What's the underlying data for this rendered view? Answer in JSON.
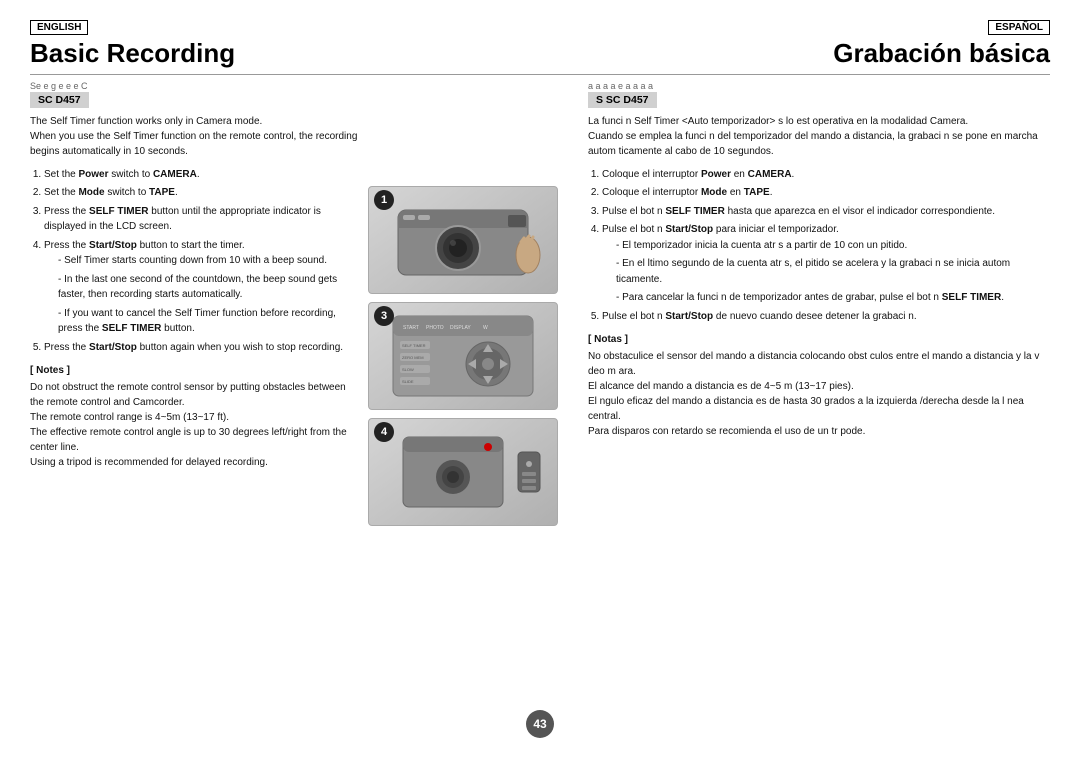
{
  "page": {
    "background": "#ffffff",
    "page_number": "43"
  },
  "left": {
    "lang_badge": "ENGLISH",
    "title": "Basic Recording",
    "model_label_text": "Se  e    g  e  e  e C",
    "model_code": "SC  D457",
    "description": [
      "The Self Timer function works only in Camera mode.",
      "When you use the Self Timer function on the remote control, the recording begins automatically in 10 seconds."
    ],
    "steps": [
      {
        "num": 1,
        "text": "Set the ",
        "bold_word": "Power",
        "text2": " switch to ",
        "bold_word2": "CAMERA",
        "text3": "."
      },
      {
        "num": 2,
        "text": "Set the ",
        "bold_word": "Mode",
        "text2": " switch to ",
        "bold_word2": "TAPE",
        "text3": "."
      },
      {
        "num": 3,
        "text": "Press the ",
        "bold_word": "SELF TIMER",
        "text2": " button until the appropriate indicator is displayed in the LCD screen."
      },
      {
        "num": 4,
        "text": "Press the ",
        "bold_word": "Start/Stop",
        "text2": " button to start the timer.",
        "bullets": [
          "Self Timer starts counting down from 10 with a beep sound.",
          "In the last one second of the countdown, the beep sound gets faster, then recording starts automatically.",
          "If you want to cancel the Self Timer function before recording, press the SELF TIMER button."
        ]
      },
      {
        "num": 5,
        "text": "Press the ",
        "bold_word": "Start/Stop",
        "text2": " button again when you wish to stop recording."
      }
    ],
    "notes_title": "[ Notes ]",
    "notes": [
      "Do not obstruct the remote control sensor by putting obstacles between the remote control and Camcorder.",
      "The remote control range is 4~5m (13~17 ft).",
      "The effective remote control angle is up to 30 degrees left/right from the center line.",
      "Using a tripod is recommended for delayed recording."
    ]
  },
  "right": {
    "lang_badge": "ESPAÑOL",
    "title": "Grabación básica",
    "model_label_text": "a  a      a      a   e  a     a   a     a",
    "model_code": "S   SC  D457",
    "description": [
      "La funci n Self Timer <Auto temporizador> s lo est  operativa en la modalidad Camera.",
      "Cuando se emplea la funci n del temporizador del mando a distancia, la grabaci n se pone en marcha autom ticamente al cabo de 10 segundos."
    ],
    "steps": [
      {
        "num": 1,
        "text": "Coloque el interruptor ",
        "bold_word": "Power",
        "text2": " en ",
        "bold_word2": "CAMERA",
        "text3": "."
      },
      {
        "num": 2,
        "text": "Coloque el interruptor ",
        "bold_word": "Mode",
        "text2": " en ",
        "bold_word2": "TAPE",
        "text3": "."
      },
      {
        "num": 3,
        "text": "Pulse el bot n ",
        "bold_word": "SELF TIMER",
        "text2": " hasta que aparezca en el visor el indicador correspondiente."
      },
      {
        "num": 4,
        "text": "Pulse el bot n ",
        "bold_word": "Start/Stop",
        "text2": " para iniciar el temporizador.",
        "bullets": [
          "El temporizador inicia la cuenta atr s a partir de 10 con un pitido.",
          "En el  ltimo segundo de la cuenta atr s, el pitido se acelera y la grabaci n se inicia autom ticamente.",
          "Para cancelar la funci n de temporizador antes de grabar, pulse el bot n SELF TIMER."
        ]
      },
      {
        "num": 5,
        "text": "Pulse el bot n ",
        "bold_word": "Start/Stop",
        "text2": " de nuevo cuando desee detener la grabaci n."
      }
    ],
    "notes_title": "[ Notas ]",
    "notes": [
      "No obstaculice el sensor del mando a distancia colocando obst culos entre el mando a distancia y la v deo m ara.",
      "El alcance del mando a distancia es de 4~5 m (13~17 pies).",
      "El  ngulo eficaz del mando a distancia es de hasta 30 grados a la izquierda /derecha desde la l nea central.",
      "Para disparos con retardo se recomienda el uso de un tr pode."
    ]
  }
}
